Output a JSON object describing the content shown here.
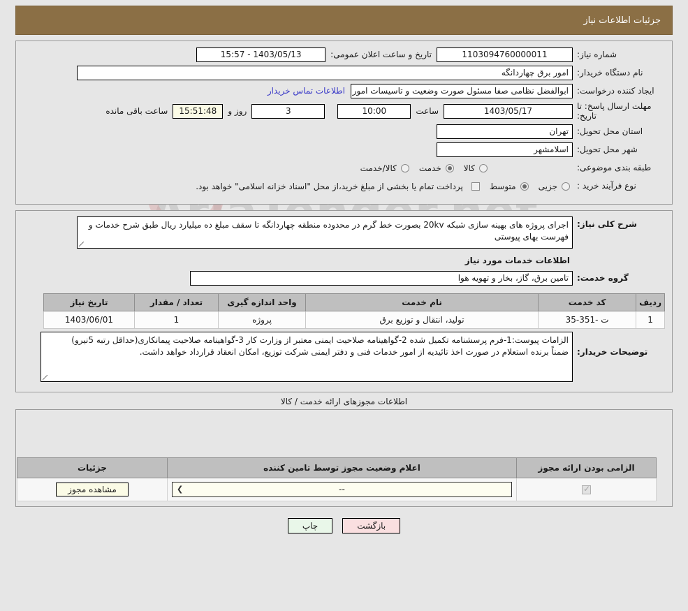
{
  "header": {
    "title": "جزئیات اطلاعات نیاز"
  },
  "fields": {
    "need_number_label": "شماره نیاز:",
    "need_number_value": "1103094760000011",
    "announce_label": "تاریخ و ساعت اعلان عمومی:",
    "announce_value": "1403/05/13 - 15:57",
    "buyer_org_label": "نام دستگاه خریدار:",
    "buyer_org_value": "امور برق چهاردانگه",
    "creator_label": "ایجاد کننده درخواست:",
    "creator_value": "ابوالفضل نظامی صفا مسئول صورت وضعیت و تاسیسات امور برق چهاردانگه",
    "contact_link": "اطلاعات تماس خریدار",
    "deadline_label": "مهلت ارسال پاسخ: تا تاریخ:",
    "deadline_date": "1403/05/17",
    "hour_label": "ساعت",
    "hour_value": "10:00",
    "days_value": "3",
    "days_label": "روز و",
    "timer_value": "15:51:48",
    "timer_label": "ساعت باقی مانده",
    "province_label": "استان محل تحویل:",
    "province_value": "تهران",
    "city_label": "شهر محل تحویل:",
    "city_value": "اسلامشهر"
  },
  "category": {
    "label": "طبقه بندی موضوعی:",
    "options": [
      {
        "label": "کالا",
        "selected": false
      },
      {
        "label": "خدمت",
        "selected": true
      },
      {
        "label": "کالا/خدمت",
        "selected": false
      }
    ]
  },
  "process": {
    "label": "نوع فرآیند خرید :",
    "options": [
      {
        "label": "جزیی",
        "selected": false
      },
      {
        "label": "متوسط",
        "selected": true
      }
    ],
    "checkbox_note": "پرداخت تمام یا بخشی از مبلغ خرید،از محل \"اسناد خزانه اسلامی\" خواهد بود."
  },
  "description": {
    "label": "شرح کلی نیاز:",
    "value": "اجرای پروژه های بهینه سازی شبکه 20kv بصورت خط گرم در محدوده منطقه چهاردانگه تا سقف مبلغ ده میلیارد ریال طبق شرح خدمات و فهرست بهای پیوستی"
  },
  "services_section": {
    "heading": "اطلاعات خدمات مورد نیاز",
    "group_label": "گروه خدمت:",
    "group_value": "تامین برق، گاز، بخار و تهویه هوا"
  },
  "services_table": {
    "columns": [
      "ردیف",
      "کد خدمت",
      "نام خدمت",
      "واحد اندازه گیری",
      "تعداد / مقدار",
      "تاریخ نیاز"
    ],
    "rows": [
      {
        "row": "1",
        "code": "ت -351-35",
        "name": "تولید، انتقال و توزیع برق",
        "unit": "پروژه",
        "qty": "1",
        "date": "1403/06/01"
      }
    ]
  },
  "buyer_notes": {
    "label": "توضیحات خریدار:",
    "value": "الزامات پیوست:1-فرم پرسشنامه تکمیل شده 2-گواهینامه صلاحیت ایمنی معتبر از وزارت کار 3-گواهینامه صلاحیت پیمانکاری(حداقل رتبه 5نیرو)\nضمناً برنده استعلام در صورت اخذ تائیدیه از امور خدمات فنی و دفتر ایمنی شرکت توزیع، امکان انعقاد قرارداد خواهد داشت."
  },
  "permits_section": {
    "heading": "اطلاعات مجوزهای ارائه خدمت / کالا",
    "columns": [
      "الزامی بودن ارائه مجوز",
      "اعلام وضعیت مجوز توسط تامین کننده",
      "جزئیات"
    ],
    "rows": [
      {
        "required": true,
        "status_value": "--",
        "details_button": "مشاهده مجوز"
      }
    ]
  },
  "footer": {
    "print_label": "چاپ",
    "back_label": "بازگشت"
  },
  "watermark": {
    "text": "AriaTender.net"
  },
  "colors": {
    "header_bg": "#8b6f45",
    "link": "#3b3bc8",
    "print_btn": "#e9f7e9",
    "back_btn": "#fadfe0",
    "cream_field": "#fbfbe6",
    "table_header": "#bfbfbf"
  }
}
